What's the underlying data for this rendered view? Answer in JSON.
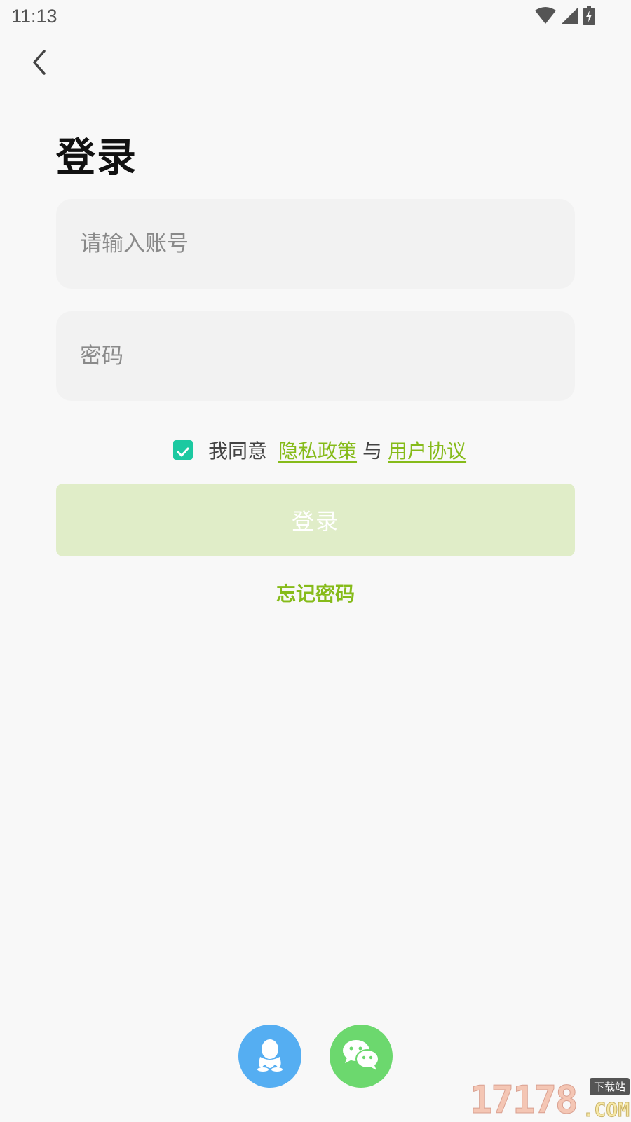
{
  "status_bar": {
    "time": "11:13",
    "icons": [
      "wifi-icon",
      "signal-icon",
      "battery-charging-icon"
    ]
  },
  "nav": {
    "back_icon": "chevron-left-icon"
  },
  "title": "登录",
  "form": {
    "account_placeholder": "请输入账号",
    "account_value": "",
    "password_placeholder": "密码",
    "password_value": ""
  },
  "agreement": {
    "checked": true,
    "prefix": "我同意",
    "privacy_link": "隐私政策",
    "separator": "与",
    "terms_link": "用户协议"
  },
  "login_button": "登录",
  "forgot_password": "忘记密码",
  "social": [
    {
      "name": "qq",
      "icon": "qq-penguin-icon",
      "color": "#55aef2"
    },
    {
      "name": "wechat",
      "icon": "wechat-icon",
      "color": "#6cd86e"
    }
  ],
  "watermark": {
    "digits": "17178",
    "tag": "下载站",
    "suffix": ".COM"
  },
  "colors": {
    "accent": "#86bb1a",
    "checkbox": "#1cc9a1",
    "button_disabled": "#e0edc8",
    "field_bg": "#f2f2f2",
    "page_bg": "#f8f8f8"
  }
}
